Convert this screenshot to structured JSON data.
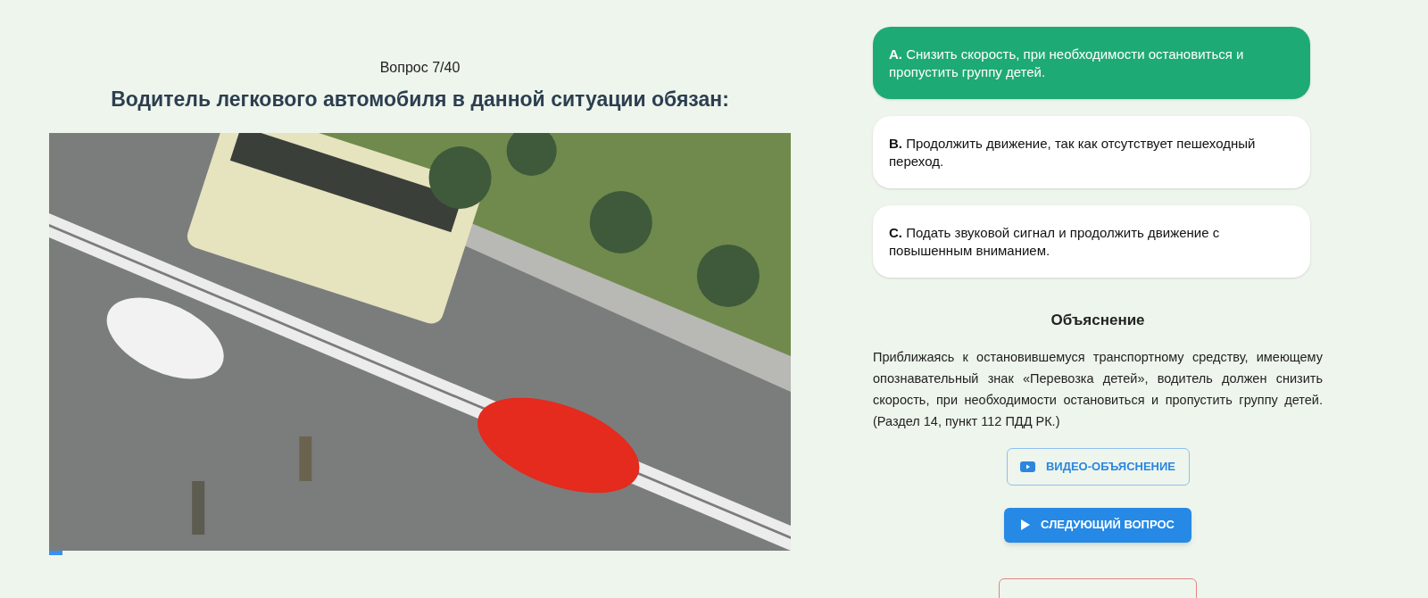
{
  "question": {
    "counter": "Вопрос 7/40",
    "title": "Водитель легкового автомобиля в данной ситуации обязан:",
    "progress": {
      "level": 0.018
    }
  },
  "answers": [
    {
      "letter": "A.",
      "text": "Снизить скорость, при необходимости остановиться и пропустить группу детей.",
      "selected": true
    },
    {
      "letter": "B.",
      "text": "Продолжить движение, так как отсутствует пешеходный переход.",
      "selected": false
    },
    {
      "letter": "C.",
      "text": "Подать звуковой сигнал и продолжить движение с повышенным вниманием.",
      "selected": false
    }
  ],
  "explanation": {
    "heading": "Объяснение",
    "text": "Приближаясь к остановившемуся транспортному средству, имеющему опознавательный знак «Перевозка детей», водитель должен снизить скорость, при необходимости остановиться и пропустить группу детей. (Раздел 14, пункт 112 ПДД РК.)"
  },
  "buttons": [
    {
      "kind": "video",
      "label": "ВИДЕО-ОБЪЯСНЕНИЕ"
    },
    {
      "kind": "next",
      "label": "СЛЕДУЮЩИЙ ВОПРОС"
    },
    {
      "kind": "danger"
    }
  ]
}
